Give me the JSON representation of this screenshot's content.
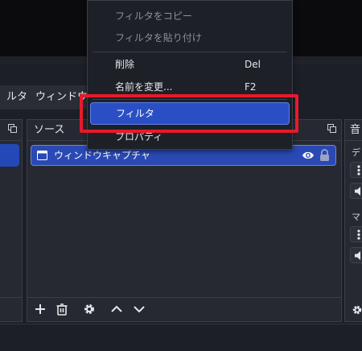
{
  "context_menu": {
    "items": [
      {
        "label": "フィルタをコピー",
        "shortcut": "",
        "disabled": true
      },
      {
        "label": "フィルタを貼り付け",
        "shortcut": "",
        "disabled": true
      },
      {
        "label": "削除",
        "shortcut": "Del",
        "disabled": false
      },
      {
        "label": "名前を変更...",
        "shortcut": "F2",
        "disabled": false
      },
      {
        "label": "フィルタ",
        "shortcut": "",
        "disabled": false,
        "selected": true
      },
      {
        "label": "プロパティ",
        "shortcut": "",
        "disabled": false
      }
    ]
  },
  "menubar": {
    "filter_label": "ルタ",
    "window_label": "ウィンドウ"
  },
  "sources_panel": {
    "title": "ソース",
    "source_name": "ウィンドウキャプチャ"
  },
  "audio_panel": {
    "title_fragment": "音",
    "device_1_fragment": "デ",
    "device_2_fragment": "マ"
  },
  "colors": {
    "highlight": "#e8192b",
    "selection": "#2a4fc4",
    "panel_bg": "#262932"
  }
}
